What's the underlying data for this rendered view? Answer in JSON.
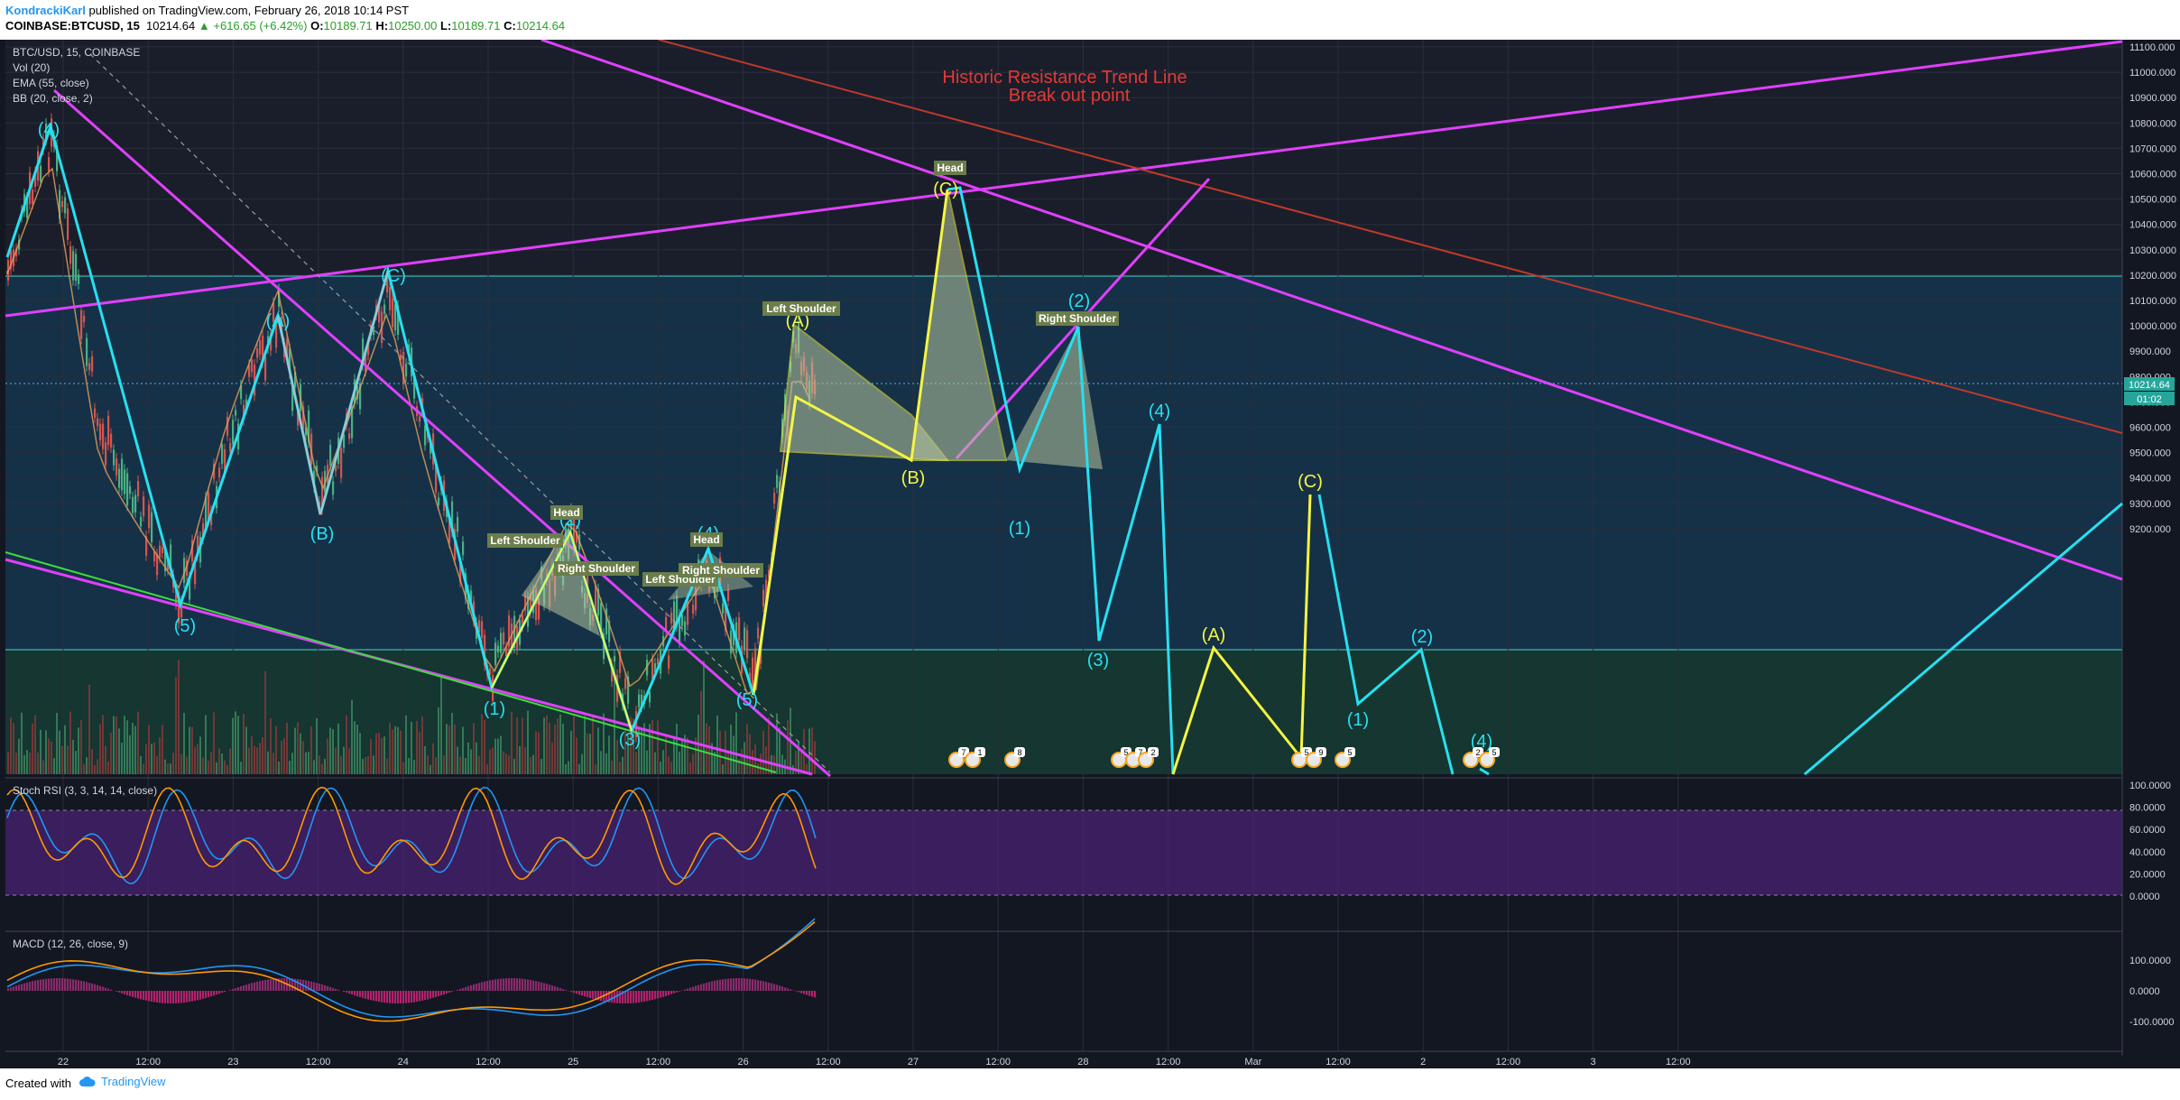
{
  "header": {
    "author": "KondrackiKarl",
    "published_text": " published on TradingView.com, February 26, 2018 10:14 PST",
    "symbol": "COINBASE:BTCUSD, 15",
    "price": "10214.64",
    "change": "▲ +616.65 (+6.42%)",
    "o_label": "O:",
    "o_value": "10189.71",
    "h_label": "H:",
    "h_value": "10250.00",
    "l_label": "L:",
    "l_value": "10189.71",
    "c_label": "C:",
    "c_value": "10214.64"
  },
  "legend": {
    "title": "BTC/USD, 15, COINBASE",
    "vol": "Vol (20)",
    "ema": "EMA (55, close)",
    "bb": "BB (20, close, 2)"
  },
  "annotation": {
    "line1": "Historic Resistance Trend Line",
    "line2": "Break out point"
  },
  "pattern_labels": {
    "head": "Head",
    "left_shoulder": "Left Shoulder",
    "right_shoulder": "Right Shoulder"
  },
  "price_axis": {
    "ticks": [
      "11100.000",
      "11000.000",
      "10900.000",
      "10800.000",
      "10700.000",
      "10600.000",
      "10500.000",
      "10400.000",
      "10300.000",
      "10200.000",
      "10100.000",
      "10000.000",
      "9900.000",
      "9800.000",
      "9700.000",
      "9600.000",
      "9500.000",
      "9400.000",
      "9300.000",
      "9200.000"
    ],
    "current_price": "10214.64",
    "countdown": "01:02"
  },
  "time_axis": {
    "ticks": [
      "22",
      "12:00",
      "23",
      "12:00",
      "24",
      "12:00",
      "25",
      "12:00",
      "26",
      "12:00",
      "27",
      "12:00",
      "28",
      "12:00",
      "Mar",
      "12:00",
      "2",
      "12:00",
      "3",
      "12:00"
    ]
  },
  "stoch_rsi": {
    "label": "Stoch RSI (3, 3, 14, 14, close)",
    "ticks": [
      "100.0000",
      "80.0000",
      "60.0000",
      "40.0000",
      "20.0000",
      "0.0000"
    ]
  },
  "macd": {
    "label": "MACD (12, 26, close, 9)",
    "ticks": [
      "100.0000",
      "0.0000",
      "-100.0000"
    ]
  },
  "wave_labels": {
    "w_4_top": "(4)",
    "w_5a": "(5)",
    "w_A1": "(A)",
    "w_B1": "(B)",
    "w_C1": "(C)",
    "w_1a": "(1)",
    "w_2a": "(2)",
    "w_3a": "(3)",
    "w_4a": "(4)",
    "w_5b": "(5)",
    "w_A2": "(A)",
    "w_B2": "(B)",
    "w_C2": "(C)",
    "w_1b": "(1)",
    "w_2b": "(2)",
    "w_3b": "(3)",
    "w_4b": "(4)",
    "w_A3": "(A)",
    "w_C3": "(C)",
    "w_1c": "(1)",
    "w_2c": "(2)",
    "w_4c": "(4)"
  },
  "event_badges": [
    "7",
    "1",
    "8",
    "5",
    "7",
    "2",
    "5",
    "9",
    "5",
    "2",
    "5"
  ],
  "footer": {
    "created_with": "Created with",
    "brand": "TradingView"
  },
  "colors": {
    "background": "#131722",
    "magenta_line": "#e040fb",
    "cyan_wave": "#26e0f0",
    "yellow_wave": "#f5f542",
    "red_trend": "#c0392b",
    "green_line": "#3ddc3d",
    "annotation_red": "#e53935",
    "price_badge": "#26a69a"
  }
}
